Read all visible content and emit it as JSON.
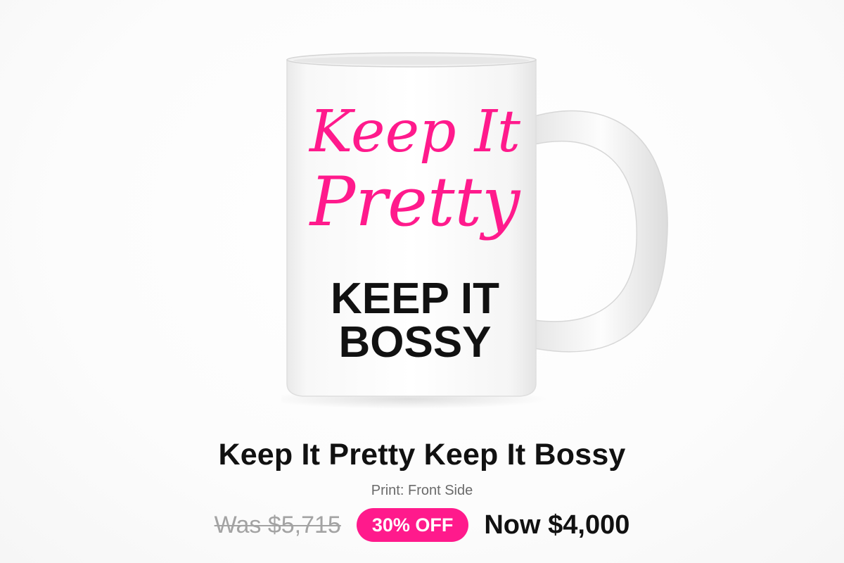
{
  "product": {
    "title": "Keep It Pretty Keep It Bossy",
    "print_side": "Print: Front Side",
    "image": {
      "script_line_1": "Keep It",
      "script_line_2": "Pretty",
      "bold_line_1": "KEEP IT",
      "bold_line_2": "BOSSY",
      "script_color": "#ff1a8c",
      "bold_color": "#111111",
      "mug_color": "#ffffff"
    }
  },
  "pricing": {
    "was": "Was $5,715",
    "discount": "30% OFF",
    "now": "Now $4,000",
    "badge_color": "#ff1a8c"
  }
}
